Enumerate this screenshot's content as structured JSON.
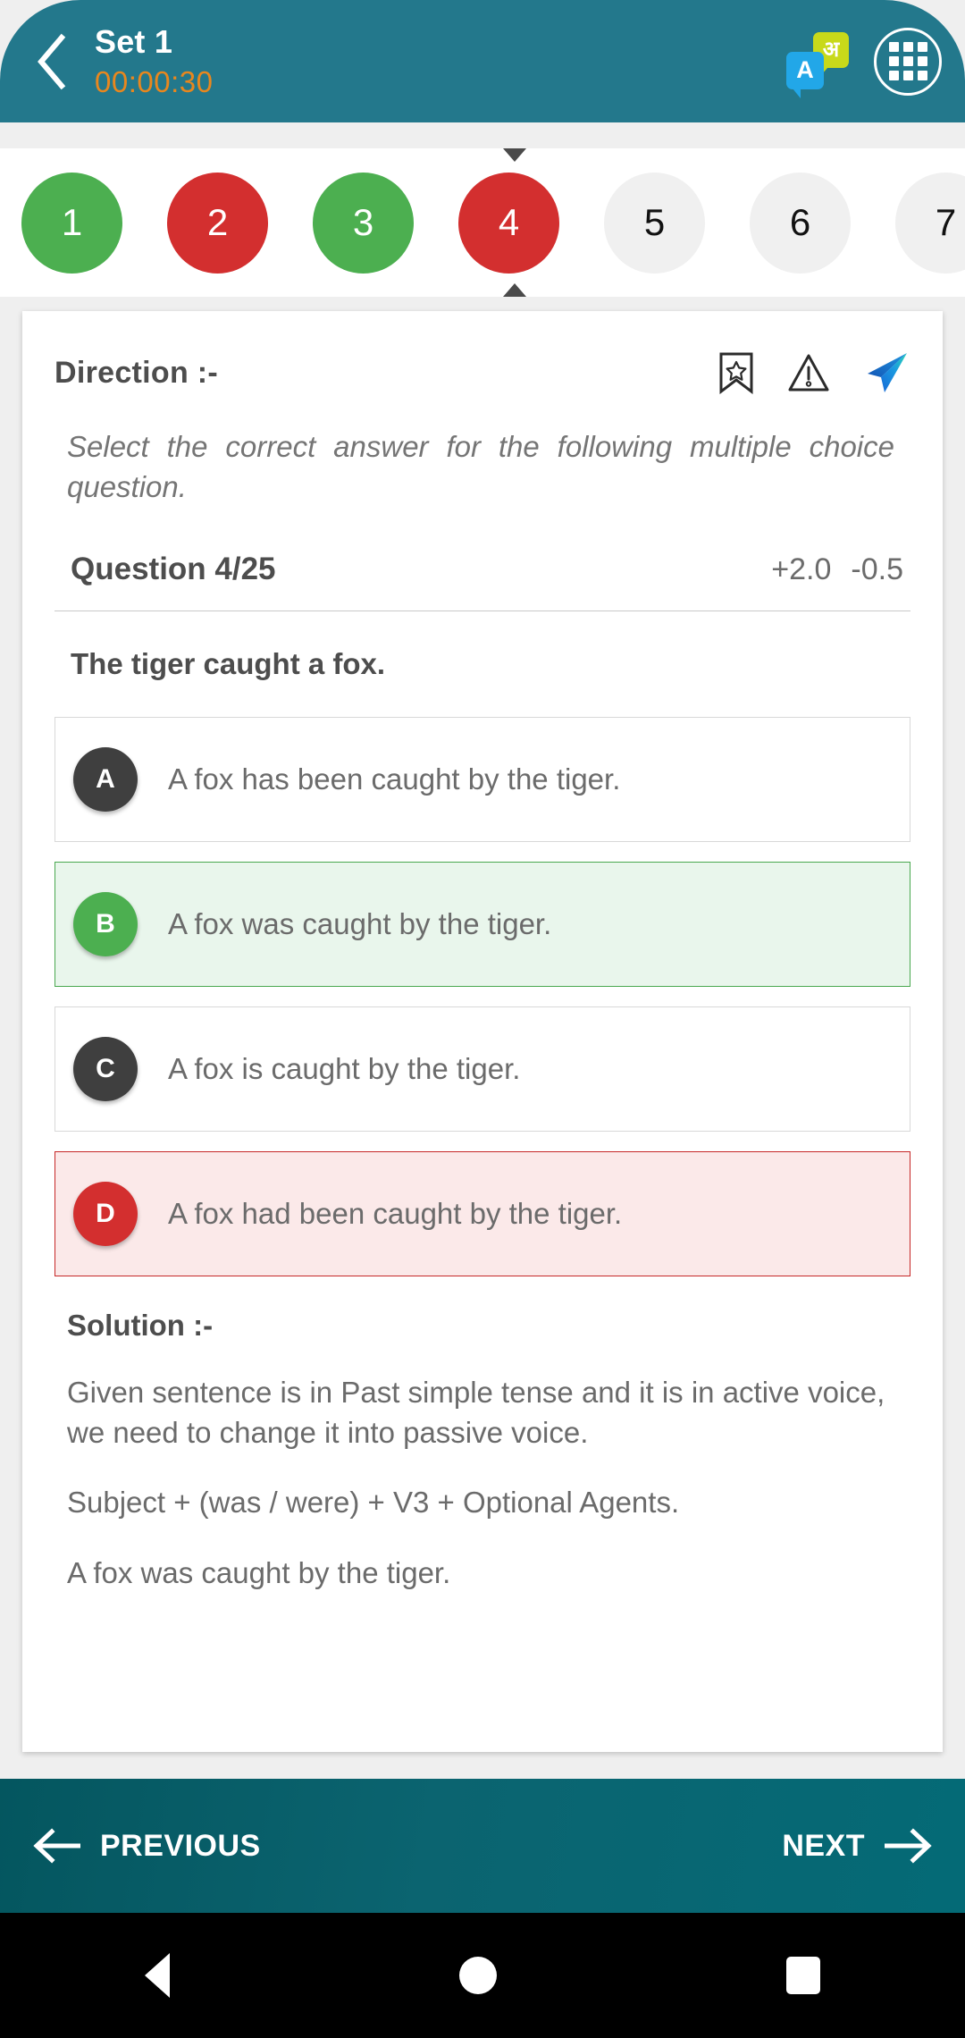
{
  "header": {
    "back_icon": "chevron-left-icon",
    "title": "Set 1",
    "timer": "00:00:30",
    "lang_primary": "A",
    "lang_secondary": "अ",
    "grid_icon": "apps-grid-icon"
  },
  "question_nav": {
    "items": [
      {
        "number": "1",
        "state": "correct"
      },
      {
        "number": "2",
        "state": "wrong"
      },
      {
        "number": "3",
        "state": "correct"
      },
      {
        "number": "4",
        "state": "wrong"
      },
      {
        "number": "5",
        "state": "unseen"
      },
      {
        "number": "6",
        "state": "unseen"
      },
      {
        "number": "7",
        "state": "unseen"
      }
    ],
    "current": "4"
  },
  "card": {
    "direction_label": "Direction  :-",
    "direction_text": "Select the correct answer for the following multiple choice question.",
    "icons": {
      "bookmark": "bookmark-star-icon",
      "report": "warning-triangle-icon",
      "share": "send-plane-icon"
    },
    "question_index": "Question 4/25",
    "marks_positive": "+2.0",
    "marks_negative": "-0.5",
    "question_text": "The tiger caught a fox.",
    "options": [
      {
        "badge": "A",
        "text": "A fox has been caught by the tiger.",
        "state": "default"
      },
      {
        "badge": "B",
        "text": "A fox was caught by the tiger.",
        "state": "correct"
      },
      {
        "badge": "C",
        "text": "A fox is caught by the tiger.",
        "state": "default"
      },
      {
        "badge": "D",
        "text": "A fox had been caught by the tiger.",
        "state": "wrong"
      }
    ],
    "solution_label": "Solution :-",
    "solution_paragraphs": [
      "Given sentence is in Past simple tense and it is in active voice, we need to change it into passive voice.",
      "Subject + (was / were) + V3 + Optional Agents.",
      "A fox was caught by the tiger."
    ]
  },
  "bottom": {
    "previous_label": "PREVIOUS",
    "next_label": "NEXT"
  },
  "system_nav": {
    "back": "android-back-icon",
    "home": "android-home-icon",
    "recents": "android-recents-icon"
  },
  "colors": {
    "header_teal": "#23788c",
    "timer_orange": "#e8871e",
    "correct_green": "#4caf50",
    "wrong_red": "#d32f2f",
    "bottom_bar": "#0b6470"
  }
}
